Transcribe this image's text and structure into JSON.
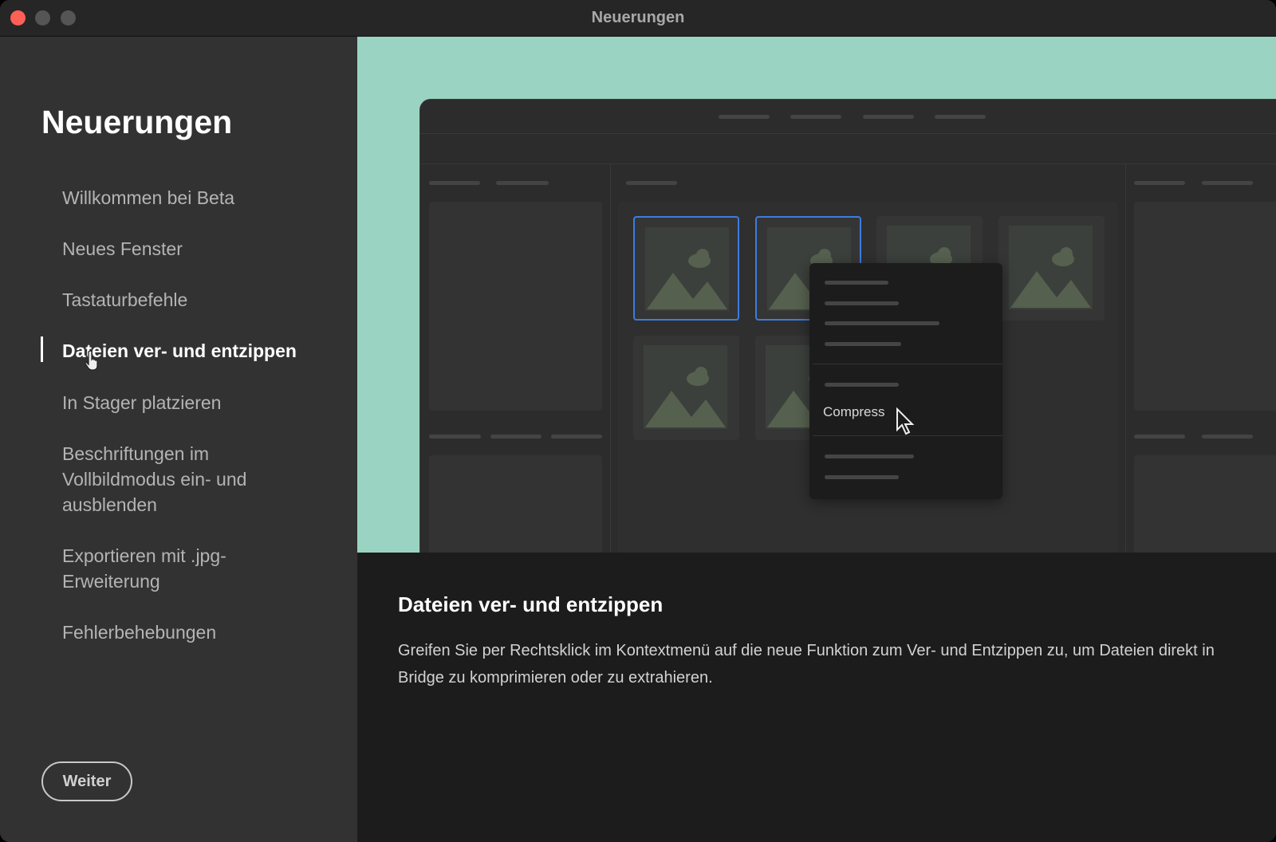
{
  "window": {
    "title": "Neuerungen"
  },
  "sidebar": {
    "heading": "Neuerungen",
    "items": [
      {
        "label": "Willkommen bei Beta"
      },
      {
        "label": "Neues Fenster"
      },
      {
        "label": "Tastaturbefehle"
      },
      {
        "label": "Dateien ver- und entzippen",
        "active": true
      },
      {
        "label": "In Stager platzieren"
      },
      {
        "label": "Beschriftungen im Vollbildmodus ein- und ausblenden"
      },
      {
        "label": "Exportieren mit .jpg-Erweiterung"
      },
      {
        "label": "Fehlerbehebungen"
      }
    ],
    "next_button": "Weiter"
  },
  "illustration": {
    "menu_item": "Compress"
  },
  "content": {
    "title": "Dateien ver- und entzippen",
    "body": "Greifen Sie per Rechtsklick im Kontextmenü auf die neue Funktion zum Ver- und Entzippen zu, um Dateien direkt in Bridge zu komprimieren oder zu extrahieren."
  },
  "colors": {
    "accent": "#3b7ddd",
    "hero_bg": "#9ad3c1",
    "close": "#fe5f57"
  }
}
